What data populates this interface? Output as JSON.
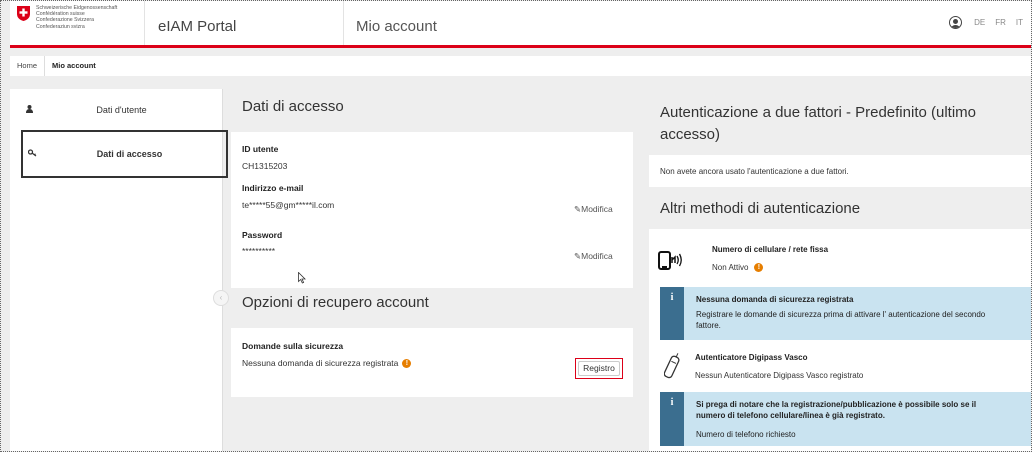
{
  "header": {
    "confederation": [
      "Schweizerische Eidgenossenschaft",
      "Confédération suisse",
      "Confederazione Svizzera",
      "Confederaziun svizra"
    ],
    "portal_name": "eIAM Portal",
    "page_title": "Mio account",
    "languages": [
      "DE",
      "FR",
      "IT"
    ],
    "brand_color": "#dc0018"
  },
  "breadcrumb": {
    "home": "Home",
    "current": "Mio account"
  },
  "sidebar": {
    "items": [
      {
        "label": "Dati d'utente",
        "icon": "user-icon",
        "active": false
      },
      {
        "label": "Dati di accesso",
        "icon": "key-icon",
        "active": true
      }
    ]
  },
  "access": {
    "title": "Dati di accesso",
    "user_id_label": "ID utente",
    "user_id_value": "CH1315203",
    "email_label": "Indirizzo e-mail",
    "email_value": "te*****55@gm*****il.com",
    "password_label": "Password",
    "password_value": "**********",
    "modify_label": "Modifica"
  },
  "recovery": {
    "title": "Opzioni di recupero account",
    "questions_label": "Domande sulla sicurezza",
    "questions_value": "Nessuna domanda di sicurezza registrata",
    "register_button": "Registro"
  },
  "twofactor": {
    "title_line1": "Autenticazione a due fattori - Predefinito (ultimo",
    "title_line2": "accesso)",
    "status_text": "Non avete ancora usato l'autenticazione a due fattori."
  },
  "other_methods": {
    "title": "Altri methodi di autenticazione",
    "phone_label": "Numero di cellulare / rete fissa",
    "phone_status": "Non Attivo",
    "info1_title": "Nessuna domanda di sicurezza registrata",
    "info1_text_line1": "Registrare le domande di sicurezza prima di attivare l' autenticazione del secondo",
    "info1_text_line2": "fattore.",
    "digipass_label": "Autenticatore Digipass Vasco",
    "digipass_status": "Nessun Autenticatore Digipass Vasco registrato",
    "info2_title_line1": "Si prega di notare che la registrazione/pubblicazione è possibile solo se il",
    "info2_title_line2": "numero di telefono cellulare/linea è già registrato.",
    "info2_text": "Numero di telefono richiesto",
    "info_color": "#c9e3f0",
    "info_strip_color": "#3b6e8f",
    "warning_color": "#e67e00"
  }
}
